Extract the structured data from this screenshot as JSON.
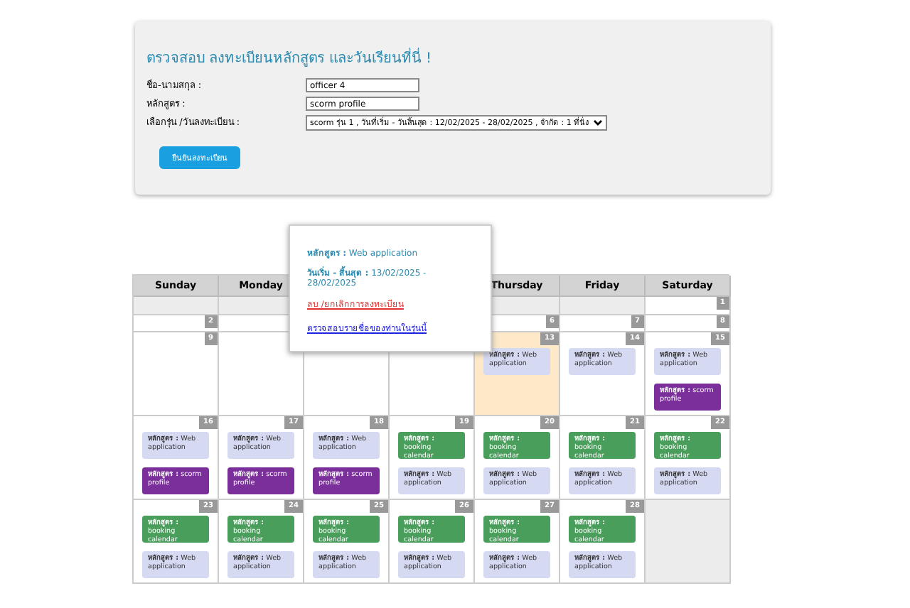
{
  "form": {
    "title": "ตรวจสอบ ลงทะเบียนหลักสูตร และวันเรียนที่นี่ !",
    "fields": [
      {
        "label": "ชื่อ-นามสกุล :",
        "value": "officer 4",
        "kind": "text"
      },
      {
        "label": "หลักสูตร :",
        "value": "scorm profile",
        "kind": "text"
      },
      {
        "label": "เลือกรุ่น /วันลงทะเบียน :",
        "value": "scorm รุ่น 1 , วันที่เริ่ม - วันสิ้นสุด : 12/02/2025 - 28/02/2025 , จำกัด : 1 ที่นั่ง",
        "kind": "select"
      }
    ],
    "button": "ยืนยันลงทะเบียน"
  },
  "calendar": {
    "columns": [
      {
        "label": "Sunday"
      },
      {
        "label": "Monday"
      },
      {},
      {},
      {
        "label": "Thursday"
      },
      {
        "label": "Friday"
      },
      {
        "label": "Saturday"
      }
    ],
    "weeks": [
      {
        "cells": [
          {
            "outside": true
          },
          {
            "outside": true
          },
          {},
          {},
          {
            "outside": true
          },
          {
            "outside": true
          },
          {
            "day": "1"
          }
        ]
      },
      {
        "cells": [
          {
            "day": "2"
          },
          {
            "outside": false
          },
          {},
          {},
          {
            "day": "6"
          },
          {
            "day": "7"
          },
          {
            "day": "8"
          }
        ]
      },
      {
        "cells": [
          {
            "day": "9"
          },
          {},
          {},
          {},
          {
            "day": "13",
            "today": true,
            "events": [
              {
                "kind": "web",
                "text": "**หลักสูตร :** Web application"
              }
            ]
          },
          {
            "day": "14",
            "events": [
              {
                "kind": "web",
                "text": "**หลักสูตร :** Web application"
              }
            ]
          },
          {
            "day": "15",
            "events": [
              {
                "kind": "web",
                "text": "**หลักสูตร :** Web application"
              },
              {
                "kind": "scorm",
                "text": "**หลักสูตร :** scorm profile"
              }
            ]
          }
        ]
      },
      {
        "cells": [
          {
            "day": "16",
            "events": [
              {
                "kind": "web",
                "text": "**หลักสูตร :** Web application"
              },
              {
                "kind": "scorm",
                "text": "**หลักสูตร :** scorm profile"
              }
            ]
          },
          {
            "day": "17",
            "events": [
              {
                "kind": "web",
                "text": "**หลักสูตร :** Web application"
              },
              {
                "kind": "scorm",
                "text": "**หลักสูตร :** scorm profile"
              }
            ]
          },
          {
            "day": "18",
            "events": [
              {
                "kind": "web",
                "text": "**หลักสูตร :** Web application"
              },
              {
                "kind": "scorm",
                "text": "**หลักสูตร :** scorm profile"
              }
            ]
          },
          {
            "day": "19",
            "events": [
              {
                "kind": "booking",
                "text": "**หลักสูตร :** booking calendar"
              },
              {
                "kind": "web",
                "text": "**หลักสูตร :** Web application"
              }
            ]
          },
          {
            "day": "20",
            "events": [
              {
                "kind": "booking",
                "text": "**หลักสูตร :** booking calendar"
              },
              {
                "kind": "web",
                "text": "**หลักสูตร :** Web application"
              }
            ]
          },
          {
            "day": "21",
            "events": [
              {
                "kind": "booking",
                "text": "**หลักสูตร :** booking calendar"
              },
              {
                "kind": "web",
                "text": "**หลักสูตร :** Web application"
              }
            ]
          },
          {
            "day": "22",
            "events": [
              {
                "kind": "booking",
                "text": "**หลักสูตร :** booking calendar"
              },
              {
                "kind": "web",
                "text": "**หลักสูตร :** Web application"
              }
            ]
          }
        ]
      },
      {
        "cells": [
          {
            "day": "23",
            "events": [
              {
                "kind": "booking",
                "text": "**หลักสูตร :** booking calendar"
              },
              {
                "kind": "web",
                "text": "**หลักสูตร :** Web application"
              }
            ]
          },
          {
            "day": "24",
            "events": [
              {
                "kind": "booking",
                "text": "**หลักสูตร :** booking calendar"
              },
              {
                "kind": "web",
                "text": "**หลักสูตร :** Web application"
              }
            ]
          },
          {
            "day": "25",
            "events": [
              {
                "kind": "booking",
                "text": "**หลักสูตร :** booking calendar"
              },
              {
                "kind": "web",
                "text": "**หลักสูตร :** Web application"
              }
            ]
          },
          {
            "day": "26",
            "events": [
              {
                "kind": "booking",
                "text": "**หลักสูตร :** booking calendar"
              },
              {
                "kind": "web",
                "text": "**หลักสูตร :** Web application"
              }
            ]
          },
          {
            "day": "27",
            "events": [
              {
                "kind": "booking",
                "text": "**หลักสูตร :** booking calendar"
              },
              {
                "kind": "web",
                "text": "**หลักสูตร :** Web application"
              }
            ]
          },
          {
            "day": "28",
            "events": [
              {
                "kind": "booking",
                "text": "**หลักสูตร :** booking calendar"
              },
              {
                "kind": "web",
                "text": "**หลักสูตร :** Web application"
              }
            ]
          },
          {
            "outside": true
          }
        ]
      }
    ]
  },
  "popup": {
    "course": "**หลักสูตร :** Web application",
    "dates": "**วันเริ่ม - สิ้นสุด :** 13/02/2025 - 28/02/2025",
    "delete_link": "ลบ /ยกเลิกการลงทะเบียน",
    "check_link": "ตรวจสอบรายชื่อของท่านในรุ่นนี้"
  }
}
